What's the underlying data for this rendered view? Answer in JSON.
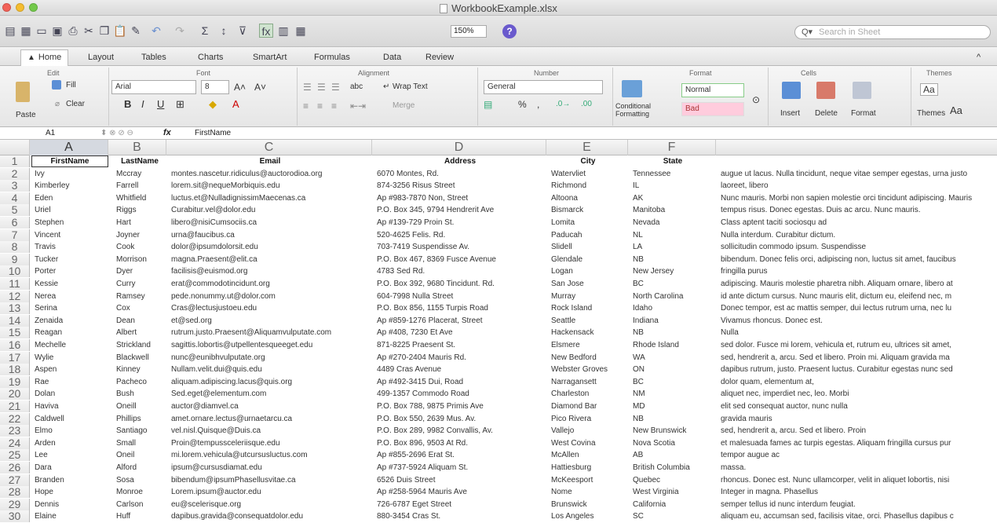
{
  "window": {
    "title": "WorkbookExample.xlsx"
  },
  "toolbar": {
    "zoom": "150%",
    "search_placeholder": "Search in Sheet"
  },
  "tabs": [
    "Home",
    "Layout",
    "Tables",
    "Charts",
    "SmartArt",
    "Formulas",
    "Data",
    "Review"
  ],
  "ribbon": {
    "groups": [
      "Edit",
      "Font",
      "Alignment",
      "Number",
      "Format",
      "Cells",
      "Themes"
    ],
    "fill_label": "Fill",
    "clear_label": "Clear",
    "paste_label": "Paste",
    "font_name": "Arial",
    "font_size": "8",
    "wrap_text_label": "Wrap Text",
    "merge_label": "Merge",
    "number_format": "General",
    "conditional_formatting_label": "Conditional\nFormatting",
    "style_normal": "Normal",
    "style_bad": "Bad",
    "insert_label": "Insert",
    "delete_label": "Delete",
    "format_label": "Format",
    "themes_label": "Themes"
  },
  "formula_bar": {
    "cell": "A1",
    "value": "FirstName"
  },
  "columns": [
    "A",
    "B",
    "C",
    "D",
    "E",
    "F"
  ],
  "headers": [
    "FirstName",
    "LastName",
    "Email",
    "Address",
    "City",
    "State"
  ],
  "rows": [
    [
      "Ivy",
      "Mccray",
      "montes.nascetur.ridiculus@auctorodioa.org",
      "6070 Montes, Rd.",
      "Watervliet",
      "Tennessee",
      "augue ut lacus. Nulla tincidunt, neque vitae semper egestas, urna justo"
    ],
    [
      "Kimberley",
      "Farrell",
      "lorem.sit@nequeMorbiquis.edu",
      "874-3256 Risus Street",
      "Richmond",
      "IL",
      "laoreet, libero"
    ],
    [
      "Eden",
      "Whitfield",
      "luctus.et@NulladignissimMaecenas.ca",
      "Ap #983-7870 Non, Street",
      "Altoona",
      "AK",
      "Nunc mauris. Morbi non sapien molestie orci tincidunt adipiscing. Mauris"
    ],
    [
      "Uriel",
      "Riggs",
      "Curabitur.vel@dolor.edu",
      "P.O. Box 345, 9794 Hendrerit Ave",
      "Bismarck",
      "Manitoba",
      "tempus risus. Donec egestas. Duis ac arcu. Nunc mauris."
    ],
    [
      "Stephen",
      "Hart",
      "libero@nisiCumsociis.ca",
      "Ap #139-729 Proin St.",
      "Lomita",
      "Nevada",
      "Class aptent taciti sociosqu ad"
    ],
    [
      "Vincent",
      "Joyner",
      "urna@faucibus.ca",
      "520-4625 Felis. Rd.",
      "Paducah",
      "NL",
      "Nulla interdum. Curabitur dictum."
    ],
    [
      "Travis",
      "Cook",
      "dolor@ipsumdolorsit.edu",
      "703-7419 Suspendisse Av.",
      "Slidell",
      "LA",
      "sollicitudin commodo ipsum. Suspendisse"
    ],
    [
      "Tucker",
      "Morrison",
      "magna.Praesent@elit.ca",
      "P.O. Box 467, 8369 Fusce Avenue",
      "Glendale",
      "NB",
      "bibendum. Donec felis orci, adipiscing non, luctus sit amet, faucibus"
    ],
    [
      "Porter",
      "Dyer",
      "facilisis@euismod.org",
      "4783 Sed Rd.",
      "Logan",
      "New Jersey",
      "fringilla purus"
    ],
    [
      "Kessie",
      "Curry",
      "erat@commodotincidunt.org",
      "P.O. Box 392, 9680 Tincidunt. Rd.",
      "San Jose",
      "BC",
      "adipiscing. Mauris molestie pharetra nibh. Aliquam ornare, libero at"
    ],
    [
      "Nerea",
      "Ramsey",
      "pede.nonummy.ut@dolor.com",
      "604-7998 Nulla Street",
      "Murray",
      "North Carolina",
      "id ante dictum cursus. Nunc mauris elit, dictum eu, eleifend nec, m"
    ],
    [
      "Serina",
      "Cox",
      "Cras@lectusjustoeu.edu",
      "P.O. Box 856, 1155 Turpis Road",
      "Rock Island",
      "Idaho",
      "Donec tempor, est ac mattis semper, dui lectus rutrum urna, nec lu"
    ],
    [
      "Zenaida",
      "Dean",
      "et@sed.org",
      "Ap #859-1276 Placerat, Street",
      "Seattle",
      "Indiana",
      "Vivamus rhoncus. Donec est."
    ],
    [
      "Reagan",
      "Albert",
      "rutrum.justo.Praesent@Aliquamvulputate.com",
      "Ap #408, 7230 Et Ave",
      "Hackensack",
      "NB",
      "Nulla"
    ],
    [
      "Mechelle",
      "Strickland",
      "sagittis.lobortis@utpellentesqueeget.edu",
      "871-8225 Praesent St.",
      "Elsmere",
      "Rhode Island",
      "sed dolor. Fusce mi lorem, vehicula et, rutrum eu, ultrices sit amet,"
    ],
    [
      "Wylie",
      "Blackwell",
      "nunc@eunibhvulputate.org",
      "Ap #270-2404 Mauris Rd.",
      "New Bedford",
      "WA",
      "sed, hendrerit a, arcu. Sed et libero. Proin mi. Aliquam gravida ma"
    ],
    [
      "Aspen",
      "Kinney",
      "Nullam.velit.dui@quis.edu",
      "4489 Cras Avenue",
      "Webster Groves",
      "ON",
      "dapibus rutrum, justo. Praesent luctus. Curabitur egestas nunc sed"
    ],
    [
      "Rae",
      "Pacheco",
      "aliquam.adipiscing.lacus@quis.org",
      "Ap #492-3415 Dui, Road",
      "Narragansett",
      "BC",
      "dolor quam, elementum at,"
    ],
    [
      "Dolan",
      "Bush",
      "Sed.eget@elementum.com",
      "499-1357 Commodo Road",
      "Charleston",
      "NM",
      "aliquet nec, imperdiet nec, leo. Morbi"
    ],
    [
      "Haviva",
      "Oneill",
      "auctor@diamvel.ca",
      "P.O. Box 788, 9875 Primis Ave",
      "Diamond Bar",
      "MD",
      "elit sed consequat auctor, nunc nulla"
    ],
    [
      "Caldwell",
      "Phillips",
      "amet.ornare.lectus@urnaetarcu.ca",
      "P.O. Box 550, 2639 Mus. Av.",
      "Pico Rivera",
      "NB",
      "gravida mauris"
    ],
    [
      "Elmo",
      "Santiago",
      "vel.nisl.Quisque@Duis.ca",
      "P.O. Box 289, 9982 Convallis, Av.",
      "Vallejo",
      "New Brunswick",
      "sed, hendrerit a, arcu. Sed et libero. Proin"
    ],
    [
      "Arden",
      "Small",
      "Proin@tempussceleriisque.edu",
      "P.O. Box 896, 9503 At Rd.",
      "West Covina",
      "Nova Scotia",
      "et malesuada fames ac turpis egestas. Aliquam fringilla cursus pur"
    ],
    [
      "Lee",
      "Oneil",
      "mi.lorem.vehicula@utcursusluctus.com",
      "Ap #855-2696 Erat St.",
      "McAllen",
      "AB",
      "tempor augue ac"
    ],
    [
      "Dara",
      "Alford",
      "ipsum@cursusdiamat.edu",
      "Ap #737-5924 Aliquam St.",
      "Hattiesburg",
      "British Columbia",
      "massa."
    ],
    [
      "Branden",
      "Sosa",
      "bibendum@ipsumPhasellusvitae.ca",
      "6526 Duis Street",
      "McKeesport",
      "Quebec",
      "rhoncus. Donec est. Nunc ullamcorper, velit in aliquet lobortis, nisi"
    ],
    [
      "Hope",
      "Monroe",
      "Lorem.ipsum@auctor.edu",
      "Ap #258-5964 Mauris Ave",
      "Nome",
      "West Virginia",
      "Integer in magna. Phasellus"
    ],
    [
      "Dennis",
      "Carlson",
      "eu@scelerisque.org",
      "726-6787 Eget Street",
      "Brunswick",
      "California",
      "semper tellus id nunc interdum feugiat."
    ],
    [
      "Elaine",
      "Huff",
      "dapibus.gravida@consequatdolor.edu",
      "880-3454 Cras St.",
      "Los Angeles",
      "SC",
      "aliquam eu, accumsan sed, facilisis vitae, orci. Phasellus dapibus c"
    ],
    [
      "Carol",
      "Gilmore",
      "Nunc.mauris.Morbi@urnajusto.com",
      "Ap #366-4664 Vulputate St.",
      "Carson City",
      "RI",
      "egestas. Aliquam"
    ]
  ]
}
